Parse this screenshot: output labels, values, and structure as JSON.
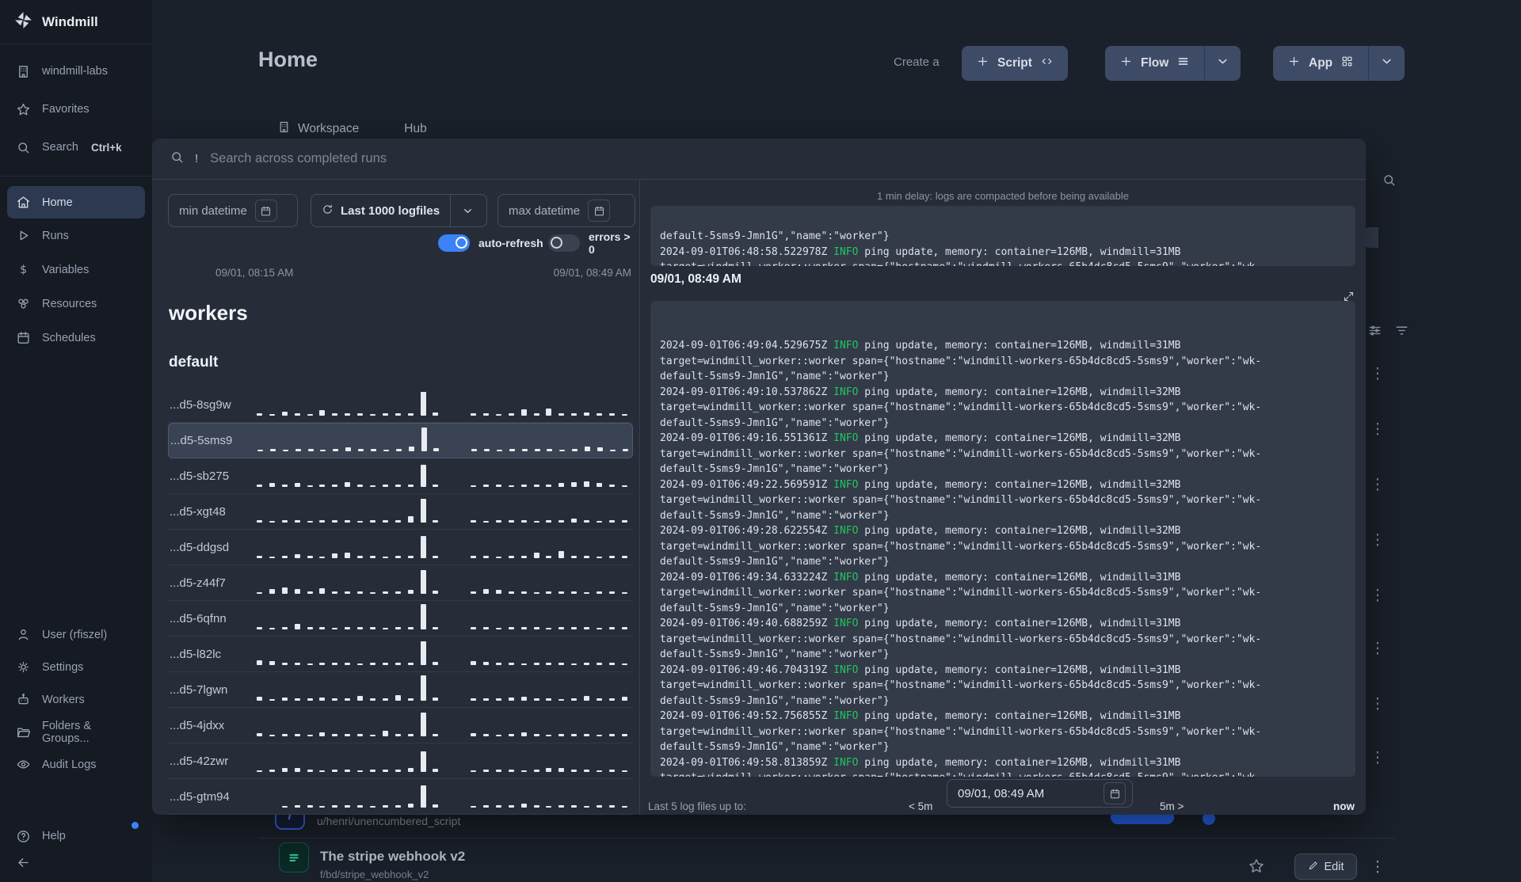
{
  "brand": {
    "name": "Windmill"
  },
  "sidebar": {
    "top_items": [
      {
        "label": "windmill-labs",
        "icon": "building"
      },
      {
        "label": "Favorites",
        "icon": "star"
      },
      {
        "label": "Search",
        "icon": "search",
        "shortcut": "Ctrl+k"
      }
    ],
    "nav_items": [
      {
        "label": "Home",
        "icon": "home",
        "active": true
      },
      {
        "label": "Runs",
        "icon": "play"
      },
      {
        "label": "Variables",
        "icon": "dollar"
      },
      {
        "label": "Resources",
        "icon": "resources"
      },
      {
        "label": "Schedules",
        "icon": "calendar"
      }
    ],
    "bottom_items": [
      {
        "label": "User (rfiszel)",
        "icon": "user"
      },
      {
        "label": "Settings",
        "icon": "gear"
      },
      {
        "label": "Workers",
        "icon": "robot"
      },
      {
        "label": "Folders & Groups...",
        "icon": "folder"
      },
      {
        "label": "Audit Logs",
        "icon": "eye"
      }
    ],
    "help_label": "Help"
  },
  "header": {
    "title": "Home",
    "create_label": "Create a",
    "script_label": "Script",
    "flow_label": "Flow",
    "app_label": "App"
  },
  "tabs": [
    {
      "label": "Workspace",
      "icon": "building"
    },
    {
      "label": "Hub",
      "icon": "globe"
    }
  ],
  "modal": {
    "search_prefix": "!",
    "search_placeholder": "Search across completed runs",
    "min_datetime_label": "min datetime",
    "logfiles_label": "Last 1000 logfiles",
    "max_datetime_label": "max datetime",
    "auto_refresh_label": "auto-refresh",
    "errors_label": "errors > 0",
    "range_start": "09/01, 08:15 AM",
    "range_end": "09/01, 08:49 AM",
    "workers_title": "workers",
    "group_title": "default",
    "workers": [
      {
        "name": "...d5-8sg9w",
        "selected": false,
        "bars": [
          3,
          2,
          5,
          3,
          2,
          7,
          3,
          3,
          3,
          2,
          3,
          3,
          3,
          30,
          4,
          0,
          0,
          3,
          3,
          2,
          3,
          8,
          3,
          9,
          3,
          3,
          4,
          3,
          3,
          2
        ]
      },
      {
        "name": "...d5-5sms9",
        "selected": true,
        "bars": [
          2,
          3,
          2,
          3,
          3,
          2,
          3,
          5,
          3,
          3,
          2,
          3,
          6,
          30,
          4,
          0,
          0,
          3,
          3,
          2,
          3,
          3,
          3,
          3,
          2,
          3,
          6,
          5,
          2,
          3
        ]
      },
      {
        "name": "...d5-sb275",
        "selected": false,
        "bars": [
          3,
          5,
          3,
          5,
          2,
          3,
          3,
          6,
          3,
          2,
          3,
          3,
          3,
          28,
          3,
          0,
          0,
          2,
          3,
          3,
          2,
          3,
          3,
          3,
          5,
          6,
          7,
          5,
          3,
          2
        ]
      },
      {
        "name": "...d5-xgt48",
        "selected": false,
        "bars": [
          3,
          2,
          3,
          3,
          2,
          3,
          3,
          3,
          2,
          3,
          3,
          3,
          8,
          30,
          3,
          0,
          0,
          3,
          2,
          3,
          3,
          3,
          2,
          3,
          3,
          5,
          3,
          2,
          3,
          3
        ]
      },
      {
        "name": "...d5-ddgsd",
        "selected": false,
        "bars": [
          3,
          2,
          3,
          5,
          3,
          2,
          6,
          7,
          3,
          3,
          2,
          3,
          3,
          28,
          3,
          0,
          0,
          3,
          3,
          2,
          3,
          3,
          7,
          3,
          9,
          3,
          3,
          2,
          3,
          3
        ]
      },
      {
        "name": "...d5-z44f7",
        "selected": false,
        "bars": [
          2,
          6,
          8,
          6,
          3,
          7,
          3,
          3,
          3,
          2,
          3,
          3,
          5,
          30,
          4,
          0,
          0,
          3,
          6,
          5,
          3,
          3,
          2,
          3,
          3,
          3,
          2,
          3,
          3,
          2
        ]
      },
      {
        "name": "...d5-6qfnn",
        "selected": false,
        "bars": [
          3,
          2,
          3,
          7,
          3,
          3,
          2,
          3,
          3,
          3,
          2,
          3,
          3,
          32,
          3,
          0,
          0,
          3,
          3,
          2,
          3,
          3,
          3,
          2,
          3,
          3,
          3,
          2,
          3,
          3
        ]
      },
      {
        "name": "...d5-l82lc",
        "selected": false,
        "bars": [
          6,
          5,
          3,
          3,
          2,
          3,
          3,
          3,
          2,
          3,
          3,
          3,
          3,
          30,
          4,
          0,
          0,
          5,
          4,
          3,
          3,
          2,
          3,
          3,
          3,
          2,
          3,
          3,
          3,
          2
        ]
      },
      {
        "name": "...d5-7lgwn",
        "selected": false,
        "bars": [
          5,
          2,
          4,
          3,
          3,
          4,
          3,
          3,
          6,
          3,
          3,
          7,
          3,
          32,
          4,
          0,
          0,
          3,
          3,
          3,
          4,
          5,
          3,
          3,
          2,
          3,
          6,
          3,
          3,
          5
        ]
      },
      {
        "name": "...d5-4jdxx",
        "selected": false,
        "bars": [
          4,
          2,
          3,
          3,
          2,
          5,
          3,
          3,
          3,
          2,
          7,
          3,
          3,
          30,
          3,
          0,
          0,
          4,
          3,
          2,
          3,
          5,
          3,
          2,
          3,
          3,
          3,
          2,
          3,
          3
        ]
      },
      {
        "name": "...d5-42zwr",
        "selected": false,
        "bars": [
          2,
          3,
          5,
          5,
          3,
          2,
          3,
          3,
          2,
          3,
          3,
          3,
          5,
          26,
          4,
          0,
          0,
          2,
          3,
          3,
          3,
          2,
          3,
          5,
          5,
          3,
          3,
          2,
          3,
          2
        ]
      },
      {
        "name": "...d5-gtm94",
        "selected": false,
        "bars": [
          0,
          0,
          2,
          3,
          3,
          2,
          3,
          3,
          3,
          2,
          3,
          3,
          5,
          28,
          4,
          0,
          0,
          2,
          3,
          3,
          3,
          5,
          3,
          2,
          3,
          3,
          2,
          3,
          3,
          2
        ]
      }
    ],
    "log": {
      "delay_note": "1 min delay: logs are compacted before being available",
      "level_label": "INFO",
      "partial_top_line": "default-5sms9-Jmn1G\",\"name\":\"worker\"}",
      "prev_entry": {
        "ts": "2024-09-01T06:48:58.522978Z",
        "msg": "ping update, memory: container=126MB, windmill=31MB"
      },
      "wrap_line2": "target=windmill_worker::worker span={\"hostname\":\"windmill-workers-65b4dc8cd5-5sms9\",\"worker\":\"wk-",
      "wrap_line3": "default-5sms9-Jmn1G\",\"name\":\"worker\"}",
      "section_time": "09/01, 08:49 AM",
      "entries": [
        {
          "ts": "2024-09-01T06:49:04.529675Z",
          "msg": "ping update, memory: container=126MB, windmill=31MB"
        },
        {
          "ts": "2024-09-01T06:49:10.537862Z",
          "msg": "ping update, memory: container=126MB, windmill=32MB"
        },
        {
          "ts": "2024-09-01T06:49:16.551361Z",
          "msg": "ping update, memory: container=126MB, windmill=32MB"
        },
        {
          "ts": "2024-09-01T06:49:22.569591Z",
          "msg": "ping update, memory: container=126MB, windmill=32MB"
        },
        {
          "ts": "2024-09-01T06:49:28.622554Z",
          "msg": "ping update, memory: container=126MB, windmill=32MB"
        },
        {
          "ts": "2024-09-01T06:49:34.633224Z",
          "msg": "ping update, memory: container=126MB, windmill=31MB"
        },
        {
          "ts": "2024-09-01T06:49:40.688259Z",
          "msg": "ping update, memory: container=126MB, windmill=31MB"
        },
        {
          "ts": "2024-09-01T06:49:46.704319Z",
          "msg": "ping update, memory: container=126MB, windmill=31MB"
        },
        {
          "ts": "2024-09-01T06:49:52.756855Z",
          "msg": "ping update, memory: container=126MB, windmill=31MB"
        },
        {
          "ts": "2024-09-01T06:49:58.813859Z",
          "msg": "ping update, memory: container=126MB, windmill=31MB"
        }
      ],
      "footer": {
        "label": "Last 5 log files up to:",
        "back": "< 5m",
        "datetime": "09/01, 08:49 AM",
        "forward": "5m >",
        "now": "now"
      }
    }
  },
  "background": {
    "row1_path": "u/henri/unencumbered_script",
    "row2_title": "The stripe webhook v2",
    "row2_path": "f/bd/stripe_webhook_v2",
    "edit_label": "Edit"
  },
  "colors": {
    "accent_blue": "#3b82f6",
    "info_green": "#22c55e",
    "sidebar_bg": "#151a23",
    "modal_bg": "#262d39"
  }
}
